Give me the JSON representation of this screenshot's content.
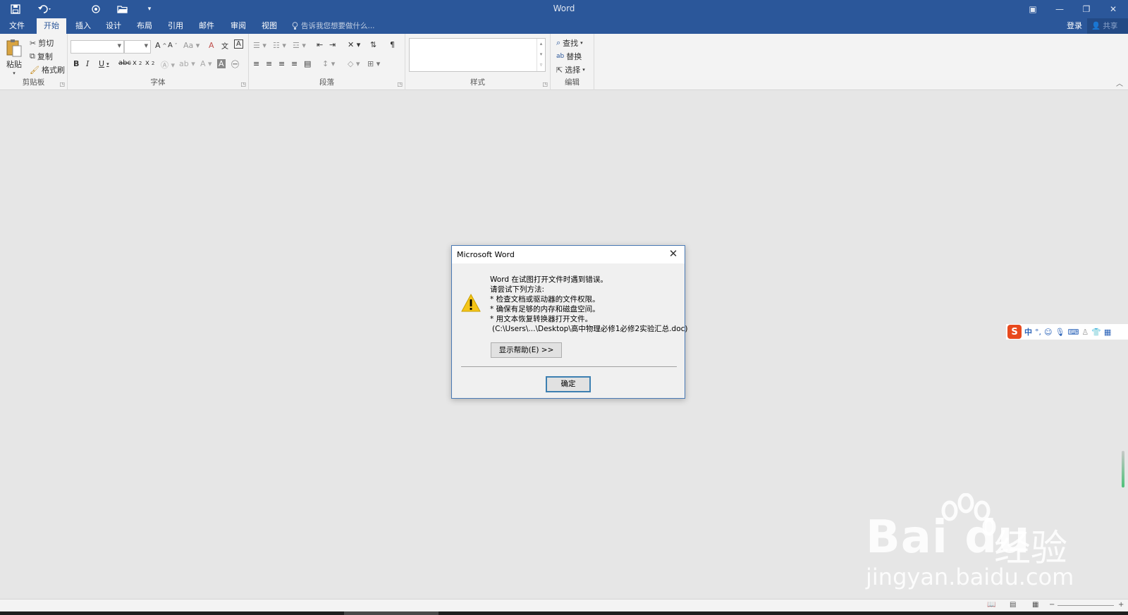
{
  "window": {
    "title": "Word",
    "qat": {
      "save_icon": "save-icon",
      "undo_icon": "undo-icon",
      "touch_icon": "touch-mode-icon",
      "open_icon": "open-folder-icon",
      "customize_icon": "customize-qat-icon"
    },
    "buttons": {
      "ribbon_options": "▣",
      "minimize": "—",
      "restore": "❐",
      "close": "✕"
    }
  },
  "tabs": [
    {
      "label": "文件"
    },
    {
      "label": "开始"
    },
    {
      "label": "插入"
    },
    {
      "label": "设计"
    },
    {
      "label": "布局"
    },
    {
      "label": "引用"
    },
    {
      "label": "邮件"
    },
    {
      "label": "审阅"
    },
    {
      "label": "视图"
    }
  ],
  "tell_me": {
    "placeholder": "告诉我您想要做什么..."
  },
  "account": {
    "login": "登录",
    "share": "共享"
  },
  "ribbon": {
    "clipboard": {
      "label": "剪贴板",
      "paste": "粘贴",
      "cut": "剪切",
      "copy": "复制",
      "format_painter": "格式刷"
    },
    "font": {
      "label": "字体",
      "font_name": "",
      "font_size": ""
    },
    "paragraph": {
      "label": "段落"
    },
    "styles": {
      "label": "样式"
    },
    "editing": {
      "label": "编辑",
      "find": "查找",
      "replace": "替换",
      "select": "选择"
    }
  },
  "dialog": {
    "title": "Microsoft Word",
    "lines": [
      "Word 在试图打开文件时遇到错误。",
      "请尝试下列方法:",
      "* 检查文档或驱动器的文件权限。",
      "* 确保有足够的内存和磁盘空间。",
      "* 用文本恢复转换器打开文件。",
      "(C:\\Users\\...\\Desktop\\高中物理必修1必修2实验汇总.doc)"
    ],
    "help_button": "显示帮助(E) >>",
    "ok_button": "确定"
  },
  "ime": {
    "logo": "S",
    "mode": "中"
  },
  "watermark": {
    "brand": "Bai du",
    "cn": "经验",
    "url": "jingyan.baidu.com"
  },
  "colors": {
    "title_bar": "#2b579a",
    "ribbon_bg": "#f3f3f3",
    "doc_bg": "#e6e6e6",
    "dialog_border": "#4a7ab5",
    "warning": "#f5c518"
  }
}
